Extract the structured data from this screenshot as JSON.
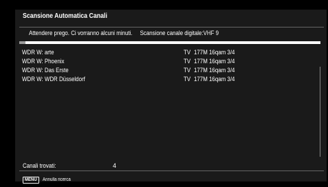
{
  "dialog": {
    "title": "Scansione Automatica Canali"
  },
  "status": {
    "wait_message": "Attendere prego. Ci vorranno alcuni minuti.",
    "scan_message": "Scansione canale digitale:VHF 9"
  },
  "progress": {
    "fraction": 0.02
  },
  "channels": [
    {
      "name": "WDR W: arte",
      "type": "TV",
      "freq": "177M 16qam 3/4"
    },
    {
      "name": "WDR W: Phoenix",
      "type": "TV",
      "freq": "177M 16qam 3/4"
    },
    {
      "name": "WDR W: Das Erste",
      "type": "TV",
      "freq": "177M 16qam 3/4"
    },
    {
      "name": "WDR W: WDR Düsseldorf",
      "type": "TV",
      "freq": "177M 16qam 3/4"
    }
  ],
  "found": {
    "label": "Canali trovati:",
    "count": "4"
  },
  "footer": {
    "key": "MENU",
    "action": "Annulla ricerca"
  },
  "colors": {
    "background": "#000000",
    "panel": "#1a1a1a",
    "text": "#ffffff",
    "progress_track": "#ffffff",
    "progress_fill": "#9a9a9a"
  }
}
